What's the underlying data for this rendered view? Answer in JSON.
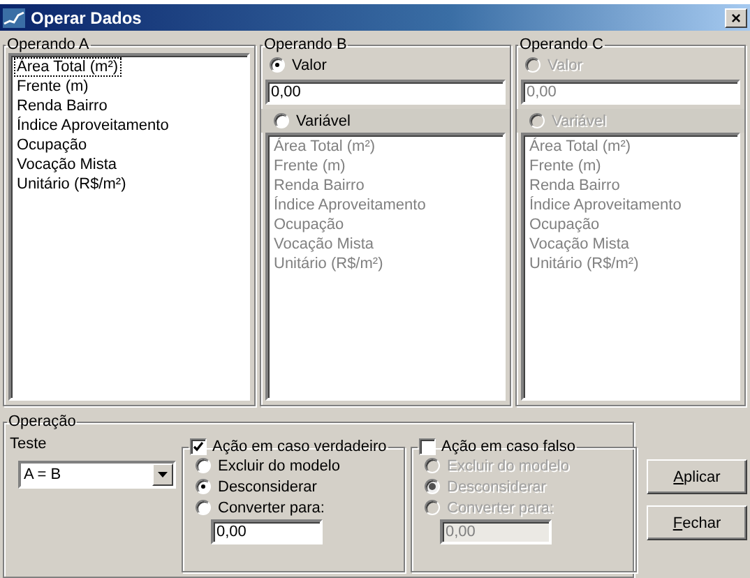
{
  "window": {
    "title": "Operar Dados",
    "close": "×"
  },
  "operand_a": {
    "title": "Operando A",
    "items": [
      {
        "label": "Área Total (m²)",
        "focused": true
      },
      {
        "label": "Frente (m)",
        "focused": false
      },
      {
        "label": "Renda Bairro",
        "focused": false
      },
      {
        "label": "Índice Aproveitamento",
        "focused": false
      },
      {
        "label": "Ocupação",
        "focused": false
      },
      {
        "label": "Vocação Mista",
        "focused": false
      },
      {
        "label": "Unitário (R$/m²)",
        "focused": false
      }
    ]
  },
  "operands": [
    {
      "title": "Operando B",
      "disabled": false,
      "value_option": {
        "label": "Valor",
        "selected": true
      },
      "value": "0,00",
      "variable_option": {
        "label": "Variável",
        "selected": false
      },
      "items": [
        "Área Total (m²)",
        "Frente (m)",
        "Renda Bairro",
        "Índice Aproveitamento",
        "Ocupação",
        "Vocação Mista",
        "Unitário (R$/m²)"
      ]
    },
    {
      "title": "Operando C",
      "disabled": true,
      "value_option": {
        "label": "Valor",
        "selected": false
      },
      "value": "0,00",
      "variable_option": {
        "label": "Variável",
        "selected": false
      },
      "items": [
        "Área Total (m²)",
        "Frente (m)",
        "Renda Bairro",
        "Índice Aproveitamento",
        "Ocupação",
        "Vocação Mista",
        "Unitário (R$/m²)"
      ]
    }
  ],
  "operation": {
    "title": "Operação",
    "test_label": "Teste",
    "test_value": "A = B",
    "actions": [
      {
        "label": "Ação em caso verdadeiro",
        "checked": true,
        "disabled": false,
        "options": [
          {
            "label": "Excluir do modelo",
            "selected": false
          },
          {
            "label": "Desconsiderar",
            "selected": true
          },
          {
            "label": "Converter para:",
            "selected": false
          }
        ],
        "value": "0,00"
      },
      {
        "label": "Ação em caso falso",
        "checked": false,
        "disabled": true,
        "options": [
          {
            "label": "Excluir do modelo",
            "selected": false
          },
          {
            "label": "Desconsiderar",
            "selected": true
          },
          {
            "label": "Converter para:",
            "selected": false
          }
        ],
        "value": "0,00"
      }
    ]
  },
  "buttons": [
    {
      "label": "Aplicar",
      "mnemonic": true
    },
    {
      "label": "Fechar",
      "mnemonic": true
    }
  ]
}
